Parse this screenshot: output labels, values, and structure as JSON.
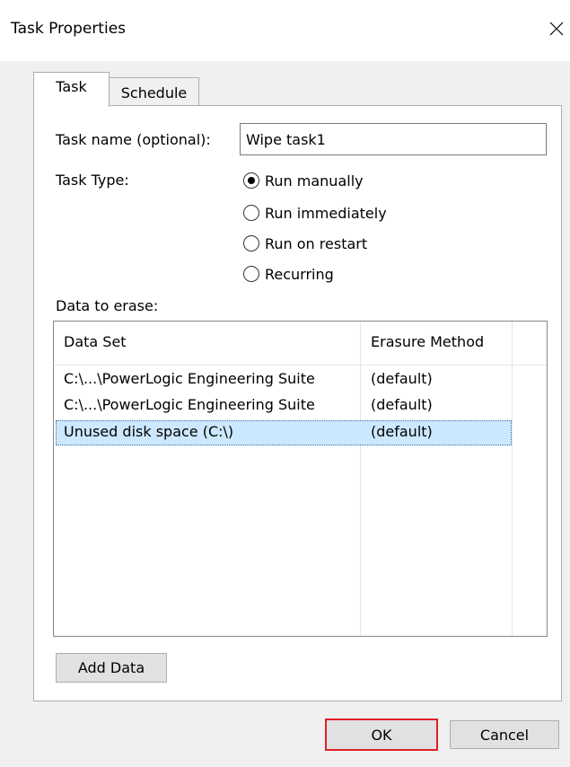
{
  "window": {
    "title": "Task Properties",
    "close_icon": "close-icon"
  },
  "tabs": [
    {
      "label": "Task",
      "selected": true
    },
    {
      "label": "Schedule",
      "selected": false
    }
  ],
  "form": {
    "task_name_label": "Task name (optional):",
    "task_name_value": "Wipe task1",
    "task_type_label": "Task Type:",
    "task_types": [
      {
        "label": "Run manually",
        "checked": true
      },
      {
        "label": "Run immediately",
        "checked": false
      },
      {
        "label": "Run on restart",
        "checked": false
      },
      {
        "label": "Recurring",
        "checked": false
      }
    ],
    "data_to_erase_label": "Data to erase:"
  },
  "data_list": {
    "columns": [
      "Data Set",
      "Erasure Method"
    ],
    "rows": [
      {
        "data_set": "C:\\...\\PowerLogic Engineering Suite",
        "method": "(default)",
        "selected": false
      },
      {
        "data_set": "C:\\...\\PowerLogic Engineering Suite",
        "method": "(default)",
        "selected": false
      },
      {
        "data_set": "Unused disk space (C:\\)",
        "method": "(default)",
        "selected": true
      }
    ]
  },
  "buttons": {
    "add_data": "Add Data",
    "ok": "OK",
    "cancel": "Cancel"
  },
  "colors": {
    "selection": "#cce8ff",
    "ok_highlight": "#e0202a",
    "dialog_bg": "#f0f0f0"
  }
}
